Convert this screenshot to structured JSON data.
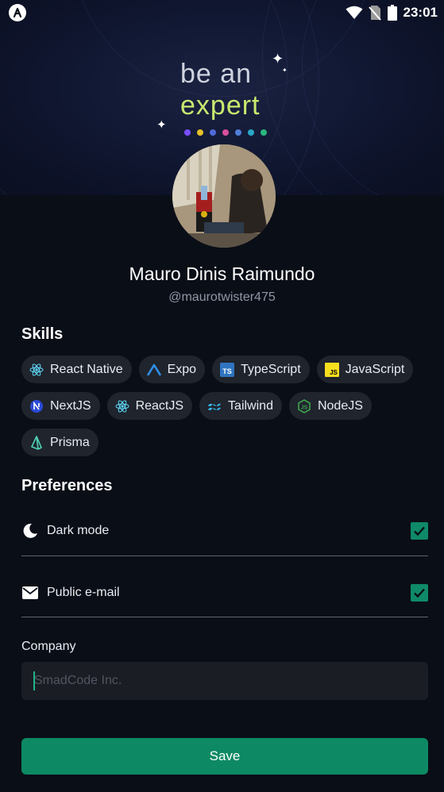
{
  "status_bar": {
    "time": "23:01",
    "icons": [
      "app-logo-icon",
      "wifi-icon",
      "no-sim-icon",
      "battery-icon"
    ]
  },
  "banner": {
    "line1": "be an",
    "line2": "expert",
    "accent": "#c8e86f"
  },
  "profile": {
    "name": "Mauro Dinis Raimundo",
    "handle": "@maurotwister475"
  },
  "skills": {
    "title": "Skills",
    "items": [
      {
        "label": "React Native",
        "icon": "react-icon"
      },
      {
        "label": "Expo",
        "icon": "expo-icon"
      },
      {
        "label": "TypeScript",
        "icon": "typescript-icon"
      },
      {
        "label": "JavaScript",
        "icon": "javascript-icon"
      },
      {
        "label": "NextJS",
        "icon": "nextjs-icon"
      },
      {
        "label": "ReactJS",
        "icon": "react-icon"
      },
      {
        "label": "Tailwind",
        "icon": "tailwind-icon"
      },
      {
        "label": "NodeJS",
        "icon": "nodejs-icon"
      },
      {
        "label": "Prisma",
        "icon": "prisma-icon"
      }
    ]
  },
  "preferences": {
    "title": "Preferences",
    "dark_mode": {
      "label": "Dark mode",
      "checked": true,
      "icon": "moon-icon"
    },
    "public_email": {
      "label": "Public e-mail",
      "checked": true,
      "icon": "mail-icon"
    }
  },
  "company": {
    "label": "Company",
    "value": "",
    "placeholder": "SmadCode Inc."
  },
  "actions": {
    "save_label": "Save"
  },
  "colors": {
    "background": "#0a0e17",
    "chip": "#1f242d",
    "primary": "#0d8a63",
    "checkbox": "#0f8a68"
  }
}
